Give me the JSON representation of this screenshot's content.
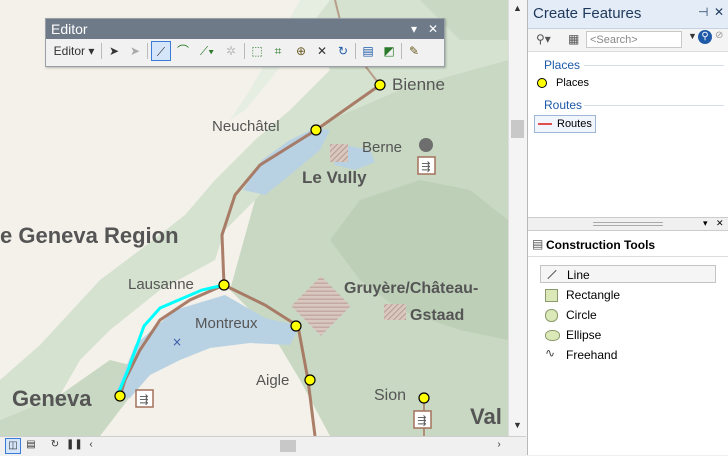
{
  "editor_toolbar": {
    "title": "Editor",
    "menu_label": "Editor ▾",
    "tools": [
      "edit-tool",
      "edit-annotation-tool",
      "straight-segment-tool",
      "endpoint-arc-tool",
      "trace-tool",
      "point-tool",
      "edit-vertices-tool",
      "reshape-feature-tool",
      "cut-polygons-tool",
      "split-tool",
      "rotate-tool",
      "attributes-tool",
      "sketch-properties-tool",
      "create-features-tool"
    ]
  },
  "map": {
    "labels": {
      "bienne": "Bienne",
      "neuchatel": "Neuchâtel",
      "berne": "Berne",
      "le_vully": "Le Vully",
      "region": "e Geneva Region",
      "lausanne": "Lausanne",
      "gruyere": "Gruyère/Château-",
      "montreux": "Montreux",
      "gstaad": "Gstaad",
      "aigle": "Aigle",
      "geneva": "Geneva",
      "sion": "Sion",
      "val": "Val"
    }
  },
  "panel": {
    "title": "Create Features",
    "search_placeholder": "<Search>",
    "groups": [
      {
        "name": "Places",
        "item": "Places"
      },
      {
        "name": "Routes",
        "item": "Routes"
      }
    ],
    "construction_title": "Construction Tools",
    "tools": [
      "Line",
      "Rectangle",
      "Circle",
      "Ellipse",
      "Freehand"
    ]
  },
  "colors": {
    "water": "#b9d2e3",
    "land_green": "#c8d8c2",
    "route": "#a3715b",
    "sketch": "#00ffff",
    "place_fill": "#ffff00",
    "accent": "#1e5aa8"
  }
}
